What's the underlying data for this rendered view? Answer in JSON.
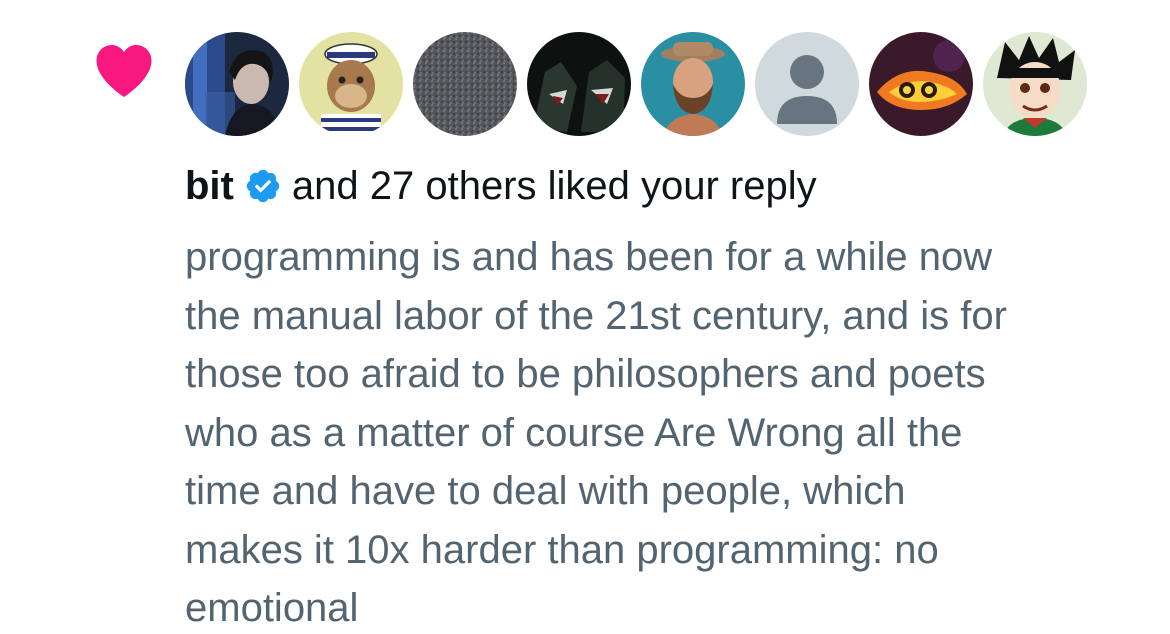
{
  "notification": {
    "type_icon": "heart-icon",
    "icon_color": "#f91880",
    "avatars": [
      {
        "name": "avatar-1",
        "icon": "dark-portrait-avatar"
      },
      {
        "name": "avatar-2",
        "icon": "ape-sailor-avatar"
      },
      {
        "name": "avatar-3",
        "icon": "noise-avatar"
      },
      {
        "name": "avatar-4",
        "icon": "wolves-avatar"
      },
      {
        "name": "avatar-5",
        "icon": "bearded-man-avatar"
      },
      {
        "name": "avatar-6",
        "icon": "default-profile-avatar"
      },
      {
        "name": "avatar-7",
        "icon": "fire-robot-avatar"
      },
      {
        "name": "avatar-8",
        "icon": "anime-boy-avatar"
      }
    ],
    "user": "bit",
    "verified_icon": "verified-badge-icon",
    "verified_color": "#1d9bf0",
    "action_text": "and 27 others liked your reply",
    "reply_lines": [
      "programming is and has been for a while now",
      "the manual labor of the 21st century, and is for",
      "those too afraid to be philosophers and poets",
      "who as a matter of course Are Wrong all the",
      "time and have to deal with people, which",
      "makes it 10x harder than programming: no",
      "emotional"
    ]
  }
}
